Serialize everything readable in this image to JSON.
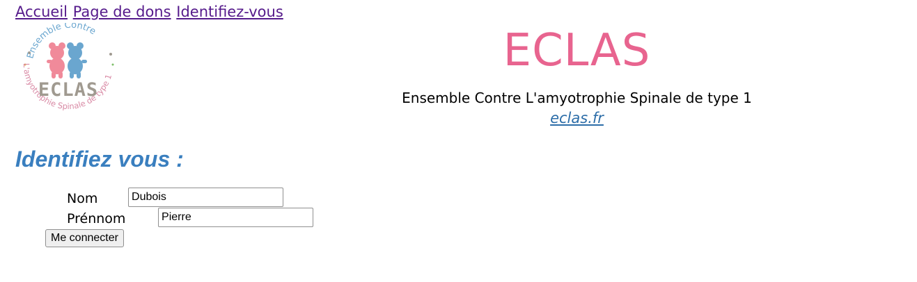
{
  "nav": {
    "home": "Accueil",
    "donations": "Page de dons",
    "login": "Identifiez-vous"
  },
  "logo": {
    "ring_top": "Ensemble Contre",
    "ring_bottom": "L'amyotrophie Spinale de type 1",
    "wordmark": "ECLAS",
    "pink": "#f08a9a",
    "blue": "#6aa6cf",
    "gray": "#a09a90"
  },
  "brand": {
    "title": "ECLAS",
    "subtitle": "Ensemble Contre L'amyotrophie Spinale de type 1",
    "link": "eclas.fr",
    "title_color": "#e8648f",
    "link_color": "#2c6da8"
  },
  "form": {
    "heading": "Identifiez vous :",
    "heading_color": "#3a7fbf",
    "name_label": "Nom",
    "name_value": "Dubois",
    "firstname_label": "Prénnom",
    "firstname_value": "Pierre",
    "submit_label": "Me connecter"
  }
}
